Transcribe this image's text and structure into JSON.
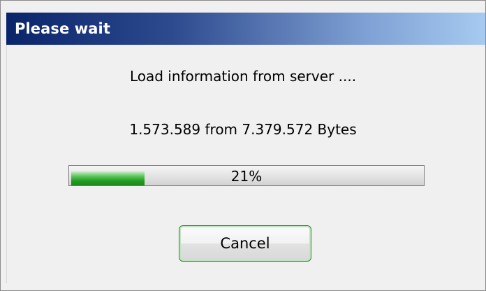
{
  "window": {
    "title": "Please wait"
  },
  "message": {
    "line1": "Load information from server ....",
    "line2": "1.573.589 from 7.379.572 Bytes"
  },
  "progress": {
    "percent": 21,
    "label": "21%"
  },
  "buttons": {
    "cancel": "Cancel"
  }
}
